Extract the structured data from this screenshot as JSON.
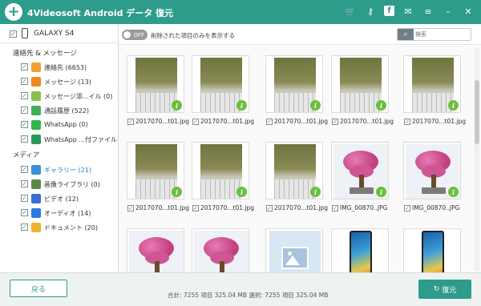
{
  "app": {
    "title": "4Videosoft Android データ 復元",
    "logo_glyph": "+",
    "toolbar_icons": [
      "cart-icon",
      "key-icon",
      "facebook-icon",
      "feedback-icon",
      "menu-icon",
      "minimize-icon",
      "close-icon"
    ],
    "accent_color": "#2e9c8a"
  },
  "sidebar": {
    "device": "GALAXY S4",
    "sections": [
      {
        "title": "連絡先 & メッセージ",
        "items": [
          {
            "label": "連絡先 (6653)",
            "icon": "contacts-icon",
            "color": "#f0a030"
          },
          {
            "label": "メッセージ (13)",
            "icon": "messages-icon",
            "color": "#f08a20"
          },
          {
            "label": "メッセージ添...イル (0)",
            "icon": "attachment-icon",
            "color": "#8cc04a"
          },
          {
            "label": "通話履歴 (522)",
            "icon": "call-log-icon",
            "color": "#3fae5a"
          },
          {
            "label": "WhatsApp (0)",
            "icon": "whatsapp-icon",
            "color": "#2fb84c"
          },
          {
            "label": "WhatsApp ...付ファイル (0)",
            "icon": "whatsapp-attachment-icon",
            "color": "#2a9a5c"
          }
        ]
      },
      {
        "title": "メディア",
        "items": [
          {
            "label": "ギャラリー (21)",
            "icon": "gallery-icon",
            "color": "#3d8fd8",
            "active": true
          },
          {
            "label": "画像ライブラリ (0)",
            "icon": "image-library-icon",
            "color": "#5a8a4a"
          },
          {
            "label": "ビデオ (12)",
            "icon": "video-icon",
            "color": "#3a6ed8"
          },
          {
            "label": "オーディオ (14)",
            "icon": "audio-icon",
            "color": "#2a7ae0"
          },
          {
            "label": "ドキュメント (20)",
            "icon": "document-icon",
            "color": "#f0b030"
          }
        ]
      }
    ]
  },
  "topbar": {
    "toggle_state": "OFF",
    "toggle_label": "削除された項目のみを表示する",
    "search_placeholder": "検索"
  },
  "grid": {
    "items": [
      {
        "caption": "2017070...t01.jpg",
        "kind": "doc"
      },
      {
        "caption": "2017070...t01.jpg",
        "kind": "doc"
      },
      {
        "caption": "2017070...t01.jpg",
        "kind": "doc"
      },
      {
        "caption": "2017070...t01.jpg",
        "kind": "doc"
      },
      {
        "caption": "2017070...t01.jpg",
        "kind": "doc"
      },
      {
        "caption": "2017070...t01.jpg",
        "kind": "doc"
      },
      {
        "caption": "2017070...t01.jpg",
        "kind": "doc"
      },
      {
        "caption": "2017070...t01.jpg",
        "kind": "doc"
      },
      {
        "caption": "IMG_00870..JPG",
        "kind": "tree"
      },
      {
        "caption": "IMG_00870..JPG",
        "kind": "tree"
      },
      {
        "caption": "",
        "kind": "tree"
      },
      {
        "caption": "",
        "kind": "tree"
      },
      {
        "caption": "",
        "kind": "placeholder"
      },
      {
        "caption": "",
        "kind": "phone"
      },
      {
        "caption": "",
        "kind": "phone"
      }
    ]
  },
  "footer": {
    "back_label": "戻る",
    "summary": "合計: 7255 項目 325.04 MB  選択: 7255 項目 325.04 MB",
    "recover_label": "復元"
  }
}
